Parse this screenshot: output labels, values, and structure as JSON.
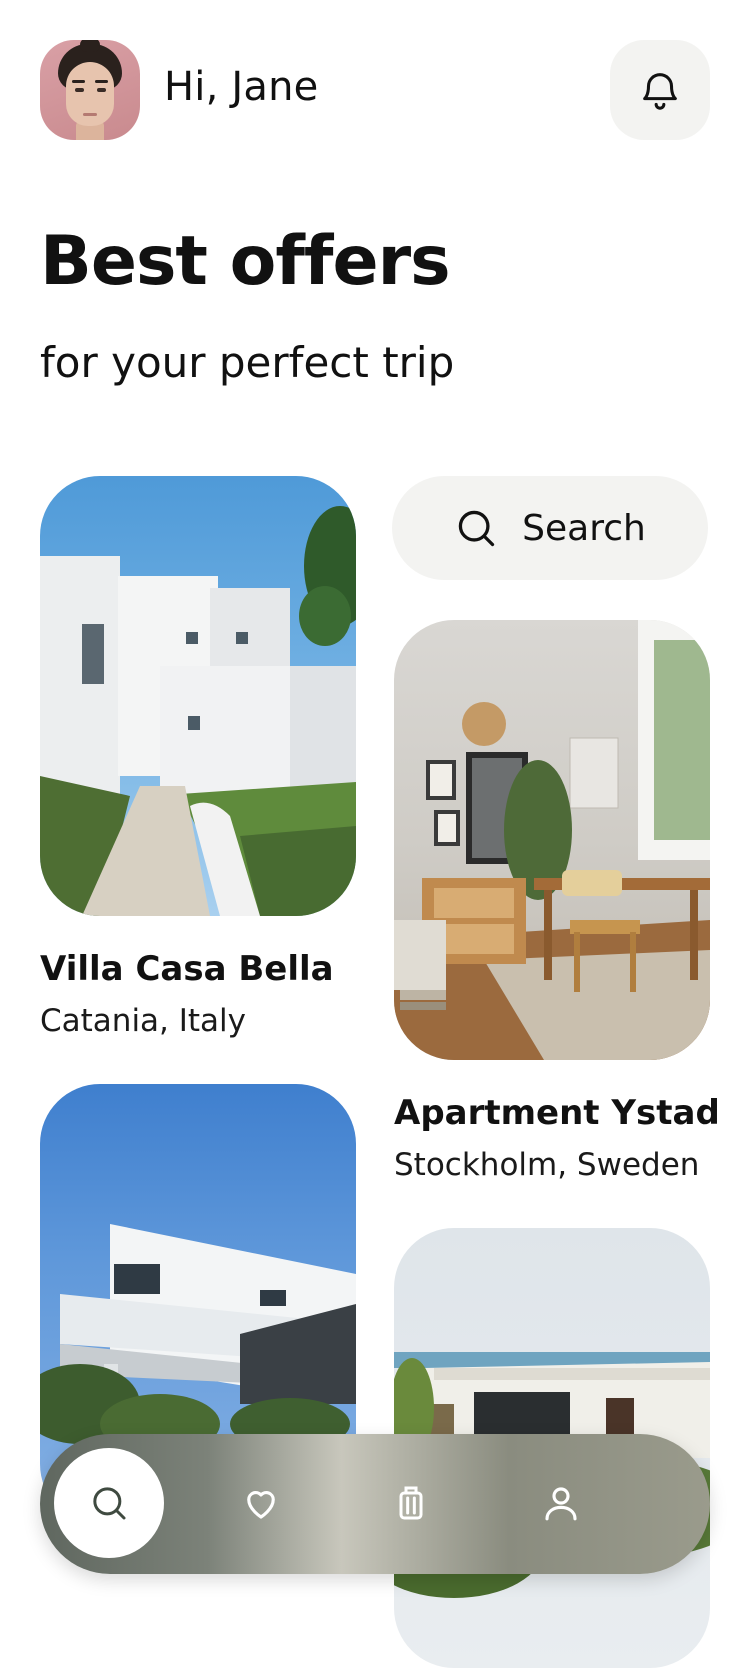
{
  "header": {
    "greeting": "Hi, Jane",
    "avatar_icon": "user-avatar",
    "bell_icon": "bell-icon"
  },
  "hero": {
    "title": "Best offers",
    "subtitle": "for your perfect trip"
  },
  "search": {
    "label": "Search",
    "icon": "search-icon"
  },
  "listings": [
    {
      "title": "Villa Casa Bella",
      "location": "Catania, Italy"
    },
    {
      "title": "Apartment Ystad",
      "location": "Stockholm, Sweden"
    },
    {
      "title": "",
      "location": ""
    },
    {
      "title": "",
      "location": ""
    }
  ],
  "tabbar": {
    "items": [
      {
        "icon": "search-icon",
        "active": true
      },
      {
        "icon": "heart-icon",
        "active": false
      },
      {
        "icon": "luggage-icon",
        "active": false
      },
      {
        "icon": "profile-icon",
        "active": false
      }
    ]
  },
  "colors": {
    "background": "#ffffff",
    "chip": "#f3f3f1",
    "text": "#111111"
  }
}
